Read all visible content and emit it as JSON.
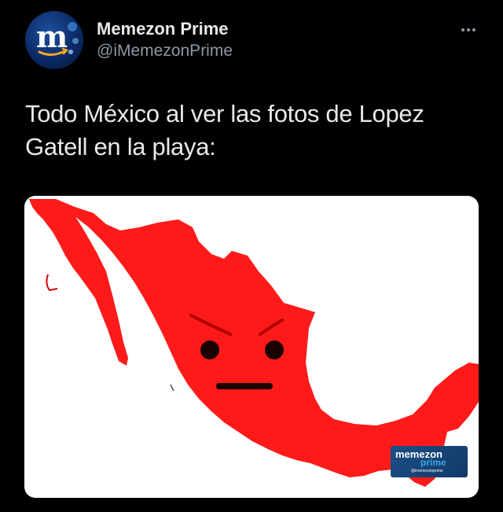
{
  "tweet": {
    "display_name": "Memezon Prime",
    "handle": "@iMemezonPrime",
    "text": "Todo México al ver las fotos de Lopez Gatell en la playa:",
    "avatar_letter": "m",
    "more_icon": "more-horizontal-icon"
  },
  "media": {
    "description_icon": "mexico-map-angry-face",
    "map_color": "#ff1a1a",
    "watermark": {
      "brand": "memezon",
      "sub": "prime",
      "handle": "@imemezonprime"
    }
  },
  "colors": {
    "background": "#000000",
    "primary_text": "#e7e9ea",
    "secondary_text": "#8b98a5"
  }
}
